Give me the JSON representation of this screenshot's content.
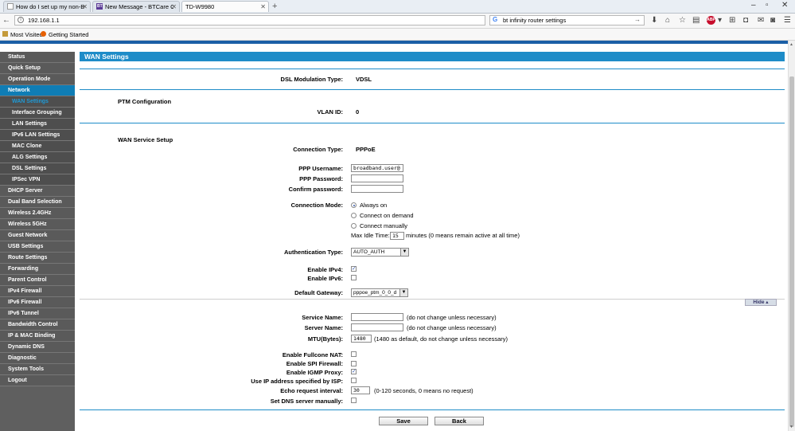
{
  "browser": {
    "tabs": [
      {
        "label": "How do I set up my non-B...",
        "active": false
      },
      {
        "label": "New Message - BTCare Co...",
        "active": false
      },
      {
        "label": "TD-W9980",
        "active": true
      }
    ],
    "url": "192.168.1.1",
    "search_value": "bt infinity router settings",
    "bookmarks": [
      "Most Visited",
      "Getting Started"
    ],
    "abp_label": "ABP"
  },
  "sidebar": {
    "items": [
      {
        "label": "Status",
        "type": "main"
      },
      {
        "label": "Quick Setup",
        "type": "main"
      },
      {
        "label": "Operation Mode",
        "type": "main"
      },
      {
        "label": "Network",
        "type": "active"
      },
      {
        "label": "WAN Settings",
        "type": "current"
      },
      {
        "label": "Interface Grouping",
        "type": "sub"
      },
      {
        "label": "LAN Settings",
        "type": "sub"
      },
      {
        "label": "IPv6 LAN Settings",
        "type": "sub"
      },
      {
        "label": "MAC Clone",
        "type": "sub"
      },
      {
        "label": "ALG Settings",
        "type": "sub"
      },
      {
        "label": "DSL Settings",
        "type": "sub"
      },
      {
        "label": "IPSec VPN",
        "type": "sub"
      },
      {
        "label": "DHCP Server",
        "type": "main"
      },
      {
        "label": "Dual Band Selection",
        "type": "main"
      },
      {
        "label": "Wireless 2.4GHz",
        "type": "main"
      },
      {
        "label": "Wireless 5GHz",
        "type": "main"
      },
      {
        "label": "Guest Network",
        "type": "main"
      },
      {
        "label": "USB Settings",
        "type": "main"
      },
      {
        "label": "Route Settings",
        "type": "main"
      },
      {
        "label": "Forwarding",
        "type": "main"
      },
      {
        "label": "Parent Control",
        "type": "main"
      },
      {
        "label": "IPv4 Firewall",
        "type": "main"
      },
      {
        "label": "IPv6 Firewall",
        "type": "main"
      },
      {
        "label": "IPv6 Tunnel",
        "type": "main"
      },
      {
        "label": "Bandwidth Control",
        "type": "main"
      },
      {
        "label": "IP & MAC Binding",
        "type": "main"
      },
      {
        "label": "Dynamic DNS",
        "type": "main"
      },
      {
        "label": "Diagnostic",
        "type": "main"
      },
      {
        "label": "System Tools",
        "type": "main"
      },
      {
        "label": "Logout",
        "type": "main"
      }
    ]
  },
  "page": {
    "title": "WAN Settings",
    "dsl_mod_label": "DSL Modulation Type:",
    "dsl_mod_value": "VDSL",
    "ptm_section": "PTM Configuration",
    "vlan_label": "VLAN ID:",
    "vlan_value": "0",
    "wan_section": "WAN Service Setup",
    "conn_type_label": "Connection Type:",
    "conn_type_value": "PPPoE",
    "ppp_user_label": "PPP Username:",
    "ppp_user_value": "broadband.user@",
    "ppp_pass_label": "PPP Password:",
    "confirm_pass_label": "Confirm password:",
    "conn_mode_label": "Connection Mode:",
    "conn_mode_options": [
      "Always on",
      "Connect on demand",
      "Connect manually"
    ],
    "max_idle_label": "Max Idle Time:",
    "max_idle_value": "15",
    "max_idle_note": "minutes (0 means remain active at all time)",
    "auth_type_label": "Authentication Type:",
    "auth_type_value": "AUTO_AUTH",
    "enable_ipv4_label": "Enable IPv4:",
    "enable_ipv6_label": "Enable IPv6:",
    "default_gw_label": "Default Gateway:",
    "default_gw_value": "pppoe_ptm_0_0_d",
    "hide_label": "Hide",
    "service_name_label": "Service Name:",
    "service_name_note": "(do not change unless necessary)",
    "server_name_label": "Server Name:",
    "server_name_note": "(do not change unless necessary)",
    "mtu_label": "MTU(Bytes):",
    "mtu_value": "1480",
    "mtu_note": "(1480 as default, do not change unless necessary)",
    "fullcone_label": "Enable Fullcone NAT:",
    "spi_label": "Enable SPI Firewall:",
    "igmp_label": "Enable IGMP Proxy:",
    "isp_ip_label": "Use IP address specified by ISP:",
    "echo_label": "Echo request interval:",
    "echo_value": "30",
    "echo_note": "(0-120 seconds, 0 means no request)",
    "dns_label": "Set DNS server manually:",
    "save_label": "Save",
    "back_label": "Back",
    "checks": {
      "ipv4": true,
      "ipv6": false,
      "fullcone": false,
      "spi": false,
      "igmp": true,
      "isp_ip": false,
      "dns": false
    }
  },
  "colors": {
    "accent": "#1e8cc8",
    "sidebar_active": "#0f7db5",
    "sidebar_bg": "#5a5a5a"
  }
}
